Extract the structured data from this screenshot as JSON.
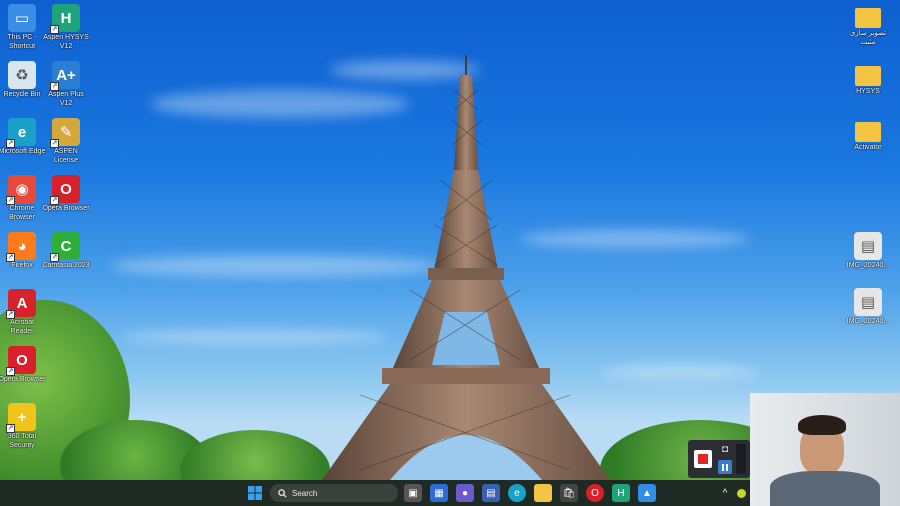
{
  "desktop_icons_left": [
    {
      "label": "This PC - Shortcut",
      "icon": "monitor-icon",
      "color": "#3a8ee6"
    },
    {
      "label": "Aspen HYSYS V12",
      "icon": "hysys-icon",
      "color": "#1fa37a"
    },
    {
      "label": "Recycle Bin",
      "icon": "recycle-bin-icon",
      "color": "#d9e6f2"
    },
    {
      "label": "Aspen Plus V12",
      "icon": "aspen-plus-icon",
      "color": "#2a7fd4"
    },
    {
      "label": "Microsoft Edge",
      "icon": "edge-icon",
      "color": "#1aa1c9"
    },
    {
      "label": "ASPEN License",
      "icon": "license-icon",
      "color": "#d4a83a"
    },
    {
      "label": "Chrome Browser",
      "icon": "chrome-icon",
      "color": "#e84a3a"
    },
    {
      "label": "Opera Browser",
      "icon": "opera-icon",
      "color": "#d81f2a"
    },
    {
      "label": "Firefox",
      "icon": "firefox-icon",
      "color": "#ff7a1a"
    },
    {
      "label": "Camtasia 2023",
      "icon": "camtasia-icon",
      "color": "#2fae3a"
    },
    {
      "label": "Acrobat Reader",
      "icon": "acrobat-icon",
      "color": "#d4232a"
    },
    {
      "label": "Opera Browser",
      "icon": "opera-icon",
      "color": "#d81f2a"
    },
    {
      "label": "360 Total Security",
      "icon": "security-icon",
      "color": "#f2c31a"
    }
  ],
  "desktop_icons_right": [
    {
      "label": "تصویر سازی مثبت",
      "icon": "folder-icon",
      "color": "#f4c542"
    },
    {
      "label": "HYSYS",
      "icon": "folder-icon",
      "color": "#f4c542"
    },
    {
      "label": "Activator",
      "icon": "folder-icon",
      "color": "#f4c542"
    },
    {
      "label": "IMG_20240...",
      "icon": "image-file-icon",
      "color": "#e6e6e6"
    },
    {
      "label": "IMG_20240...",
      "icon": "image-file-icon",
      "color": "#e6e6e6"
    }
  ],
  "taskbar": {
    "search_placeholder": "Search",
    "apps": [
      {
        "name": "start-button",
        "icon": "windows-icon"
      },
      {
        "name": "task-view",
        "icon": "task-view-icon"
      },
      {
        "name": "widgets",
        "icon": "widgets-icon"
      },
      {
        "name": "teams",
        "icon": "chat-icon"
      },
      {
        "name": "news",
        "icon": "news-icon"
      },
      {
        "name": "edge",
        "icon": "edge-icon"
      },
      {
        "name": "file-explorer",
        "icon": "folder-icon"
      },
      {
        "name": "store",
        "icon": "store-icon"
      },
      {
        "name": "opera",
        "icon": "opera-icon"
      },
      {
        "name": "hysys",
        "icon": "hysys-icon"
      },
      {
        "name": "photos",
        "icon": "photos-icon"
      }
    ]
  },
  "colors": {
    "taskbar_bg": "#1e2a23",
    "accent": "#2f8ee6"
  }
}
